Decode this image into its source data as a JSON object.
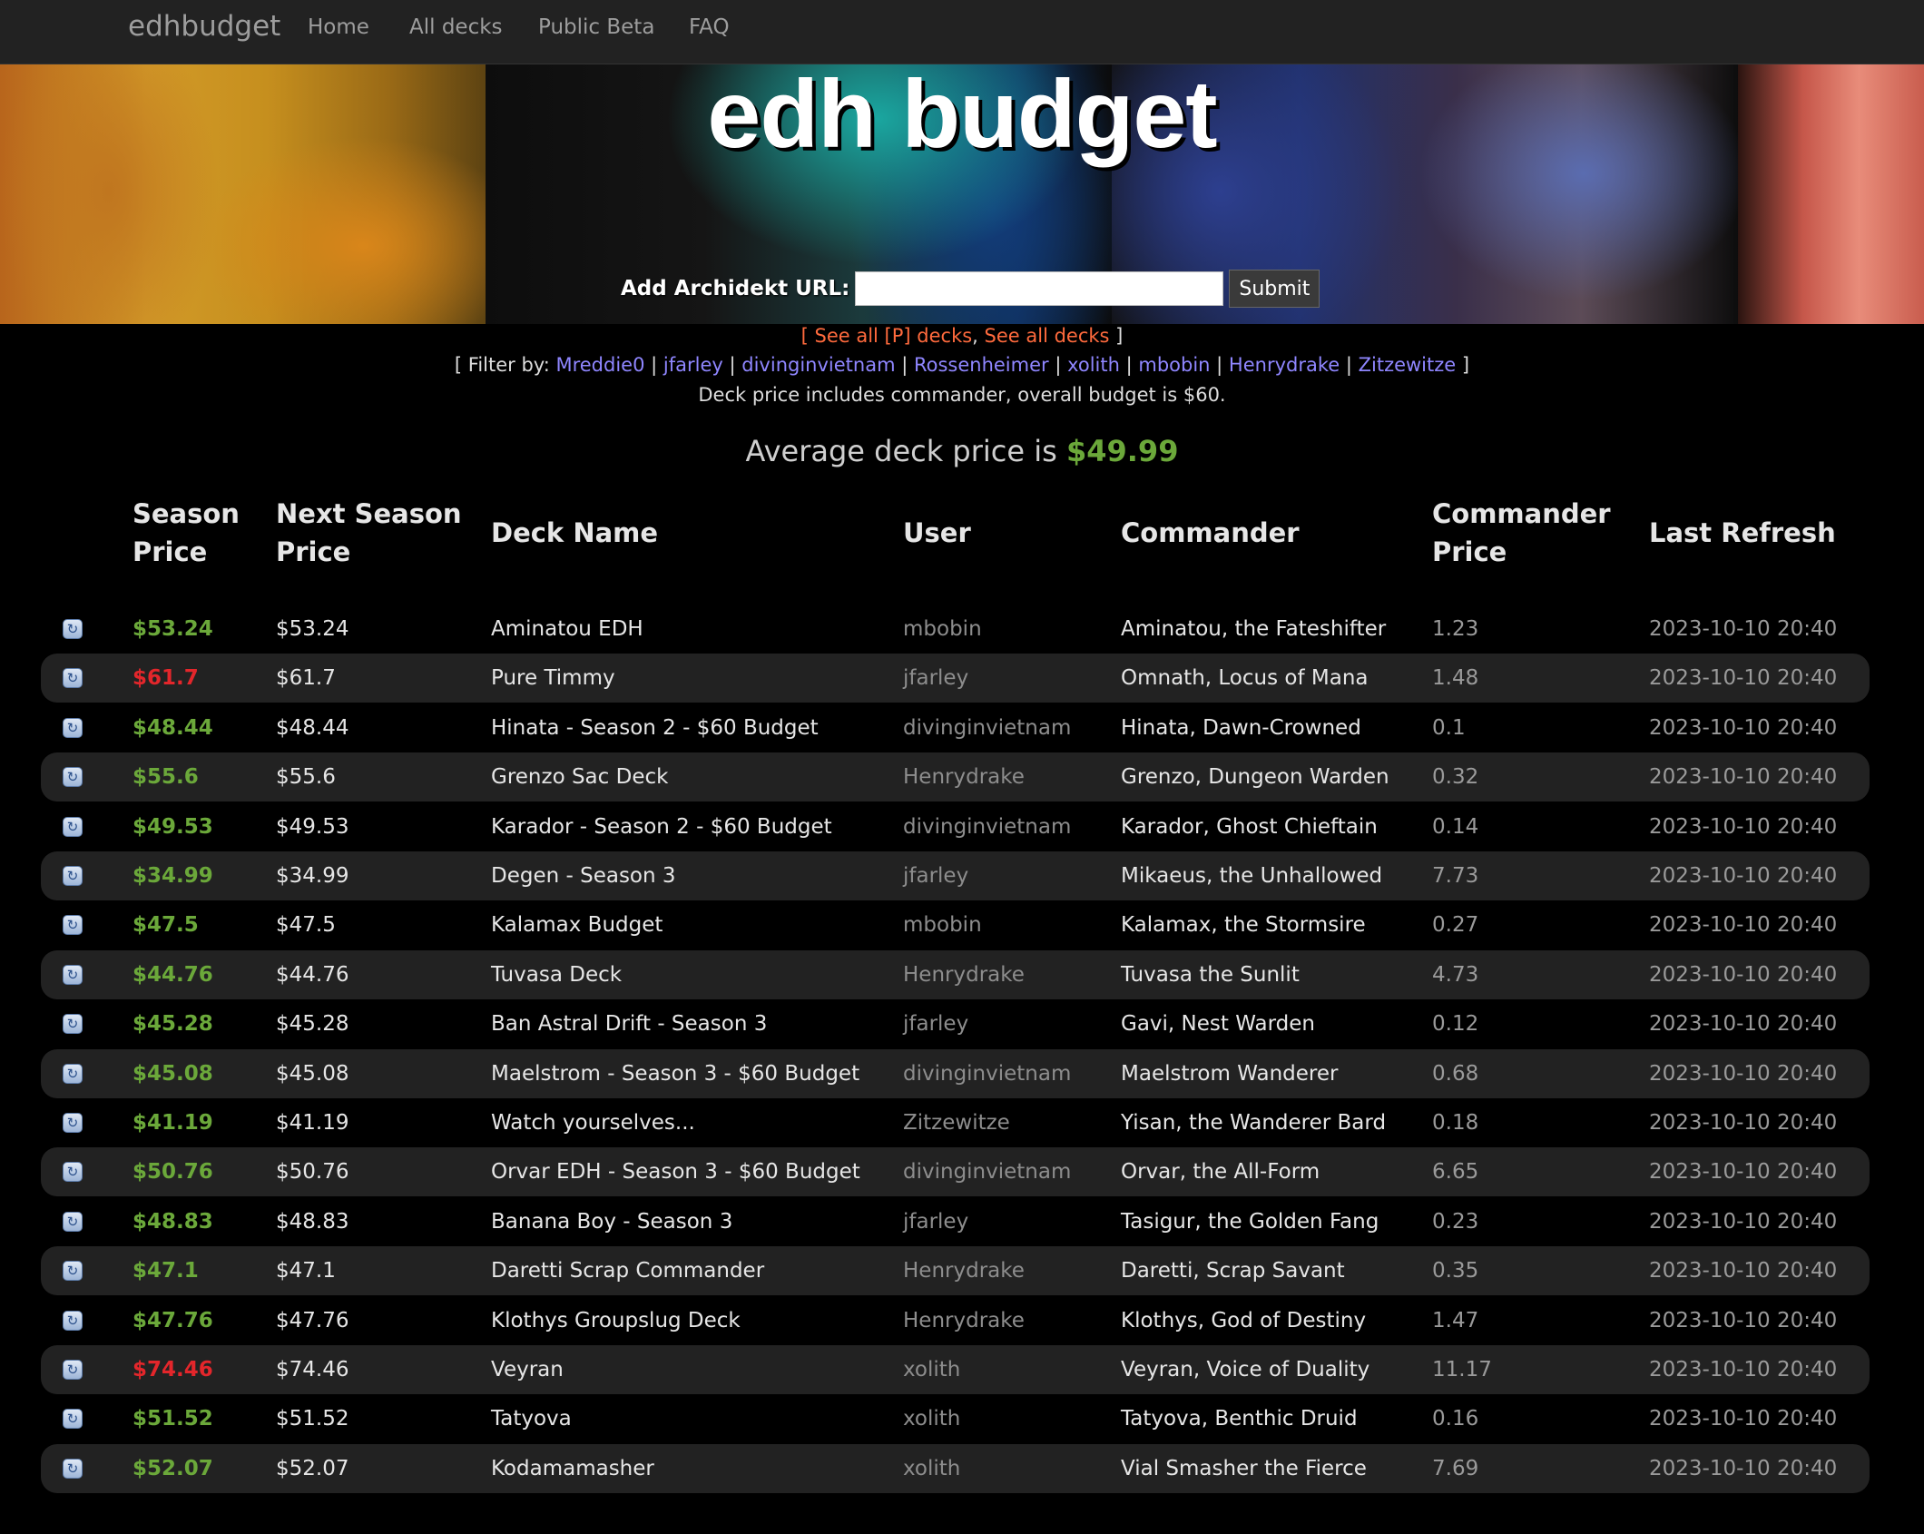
{
  "nav": {
    "brand": "edhbudget",
    "links": [
      "Home",
      "All decks",
      "Public Beta",
      "FAQ"
    ]
  },
  "hero": {
    "title": "edh budget",
    "form_label": "Add Archidekt URL:",
    "input_value": "",
    "submit_label": "Submit"
  },
  "links": {
    "see_all_p": "See all [P] decks",
    "see_all": "See all decks",
    "filter_label": "Filter by:",
    "users": [
      "Mreddie0",
      "jfarley",
      "divinginvietnam",
      "Rossenheimer",
      "xolith",
      "mbobin",
      "Henrydrake",
      "Zitzewitze"
    ],
    "note": "Deck price includes commander, overall budget is $60."
  },
  "average": {
    "label": "Average deck price is",
    "value": "$49.99"
  },
  "colors": {
    "under_budget": "#6ba83a",
    "over_budget": "#e3262b",
    "link_orange": "#ff6a3d",
    "link_user": "#8f86ff"
  },
  "table": {
    "headers": {
      "season_price": [
        "Season",
        "Price"
      ],
      "next_season_price": [
        "Next Season",
        "Price"
      ],
      "deck_name": "Deck Name",
      "user": "User",
      "commander": "Commander",
      "commander_price": [
        "Commander",
        "Price"
      ],
      "last_refresh": "Last Refresh"
    },
    "rows": [
      {
        "season": "$53.24",
        "over": false,
        "next": "$53.24",
        "deck": "Aminatou EDH",
        "user": "mbobin",
        "commander": "Aminatou, the Fateshifter",
        "cprice": "1.23",
        "refresh": "2023-10-10 20:40"
      },
      {
        "season": "$61.7",
        "over": true,
        "next": "$61.7",
        "deck": "Pure Timmy",
        "user": "jfarley",
        "commander": "Omnath, Locus of Mana",
        "cprice": "1.48",
        "refresh": "2023-10-10 20:40"
      },
      {
        "season": "$48.44",
        "over": false,
        "next": "$48.44",
        "deck": "Hinata - Season 2 - $60 Budget",
        "user": "divinginvietnam",
        "commander": "Hinata, Dawn-Crowned",
        "cprice": "0.1",
        "refresh": "2023-10-10 20:40"
      },
      {
        "season": "$55.6",
        "over": false,
        "next": "$55.6",
        "deck": "Grenzo Sac Deck",
        "user": "Henrydrake",
        "commander": "Grenzo, Dungeon Warden",
        "cprice": "0.32",
        "refresh": "2023-10-10 20:40"
      },
      {
        "season": "$49.53",
        "over": false,
        "next": "$49.53",
        "deck": "Karador - Season 2 - $60 Budget",
        "user": "divinginvietnam",
        "commander": "Karador, Ghost Chieftain",
        "cprice": "0.14",
        "refresh": "2023-10-10 20:40"
      },
      {
        "season": "$34.99",
        "over": false,
        "next": "$34.99",
        "deck": "Degen - Season 3",
        "user": "jfarley",
        "commander": "Mikaeus, the Unhallowed",
        "cprice": "7.73",
        "refresh": "2023-10-10 20:40"
      },
      {
        "season": "$47.5",
        "over": false,
        "next": "$47.5",
        "deck": "Kalamax Budget",
        "user": "mbobin",
        "commander": "Kalamax, the Stormsire",
        "cprice": "0.27",
        "refresh": "2023-10-10 20:40"
      },
      {
        "season": "$44.76",
        "over": false,
        "next": "$44.76",
        "deck": "Tuvasa Deck",
        "user": "Henrydrake",
        "commander": "Tuvasa the Sunlit",
        "cprice": "4.73",
        "refresh": "2023-10-10 20:40"
      },
      {
        "season": "$45.28",
        "over": false,
        "next": "$45.28",
        "deck": "Ban Astral Drift - Season 3",
        "user": "jfarley",
        "commander": "Gavi, Nest Warden",
        "cprice": "0.12",
        "refresh": "2023-10-10 20:40"
      },
      {
        "season": "$45.08",
        "over": false,
        "next": "$45.08",
        "deck": "Maelstrom - Season 3 - $60 Budget",
        "user": "divinginvietnam",
        "commander": "Maelstrom Wanderer",
        "cprice": "0.68",
        "refresh": "2023-10-10 20:40"
      },
      {
        "season": "$41.19",
        "over": false,
        "next": "$41.19",
        "deck": "Watch yourselves...",
        "user": "Zitzewitze",
        "commander": "Yisan, the Wanderer Bard",
        "cprice": "0.18",
        "refresh": "2023-10-10 20:40"
      },
      {
        "season": "$50.76",
        "over": false,
        "next": "$50.76",
        "deck": "Orvar EDH - Season 3 - $60 Budget",
        "user": "divinginvietnam",
        "commander": "Orvar, the All-Form",
        "cprice": "6.65",
        "refresh": "2023-10-10 20:40"
      },
      {
        "season": "$48.83",
        "over": false,
        "next": "$48.83",
        "deck": "Banana Boy - Season 3",
        "user": "jfarley",
        "commander": "Tasigur, the Golden Fang",
        "cprice": "0.23",
        "refresh": "2023-10-10 20:40"
      },
      {
        "season": "$47.1",
        "over": false,
        "next": "$47.1",
        "deck": "Daretti Scrap Commander",
        "user": "Henrydrake",
        "commander": "Daretti, Scrap Savant",
        "cprice": "0.35",
        "refresh": "2023-10-10 20:40"
      },
      {
        "season": "$47.76",
        "over": false,
        "next": "$47.76",
        "deck": "Klothys Groupslug Deck",
        "user": "Henrydrake",
        "commander": "Klothys, God of Destiny",
        "cprice": "1.47",
        "refresh": "2023-10-10 20:40"
      },
      {
        "season": "$74.46",
        "over": true,
        "next": "$74.46",
        "deck": "Veyran",
        "user": "xolith",
        "commander": "Veyran, Voice of Duality",
        "cprice": "11.17",
        "refresh": "2023-10-10 20:40"
      },
      {
        "season": "$51.52",
        "over": false,
        "next": "$51.52",
        "deck": "Tatyova",
        "user": "xolith",
        "commander": "Tatyova, Benthic Druid",
        "cprice": "0.16",
        "refresh": "2023-10-10 20:40"
      },
      {
        "season": "$52.07",
        "over": false,
        "next": "$52.07",
        "deck": "Kodamamasher",
        "user": "xolith",
        "commander": "Vial Smasher the Fierce",
        "cprice": "7.69",
        "refresh": "2023-10-10 20:40"
      }
    ]
  }
}
